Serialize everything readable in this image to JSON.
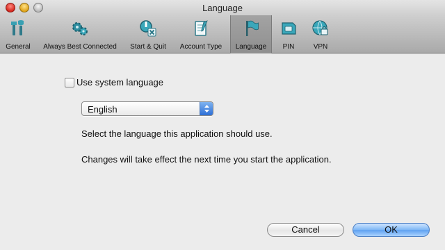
{
  "window": {
    "title": "Language"
  },
  "toolbar": {
    "items": [
      {
        "label": "General",
        "icon": "tools-icon",
        "selected": false
      },
      {
        "label": "Always Best Connected",
        "icon": "gears-icon",
        "selected": false
      },
      {
        "label": "Start & Quit",
        "icon": "start-quit-icon",
        "selected": false
      },
      {
        "label": "Account Type",
        "icon": "account-type-icon",
        "selected": false
      },
      {
        "label": "Language",
        "icon": "flag-icon",
        "selected": true
      },
      {
        "label": "PIN",
        "icon": "sim-card-icon",
        "selected": false
      },
      {
        "label": "VPN",
        "icon": "vpn-globe-lock-icon",
        "selected": false
      }
    ]
  },
  "language": {
    "use_system_label": "Use system language",
    "use_system_checked": false,
    "selected_language": "English",
    "description": "Select the language this application should use.",
    "note": "Changes will take effect the next time you start the application."
  },
  "buttons": {
    "cancel": "Cancel",
    "ok": "OK"
  },
  "colors": {
    "ok_blue": "#5ea1f0",
    "selected_tab": "#8f8f8f",
    "close_red": "#d6261d",
    "min_yellow": "#e0a318"
  }
}
